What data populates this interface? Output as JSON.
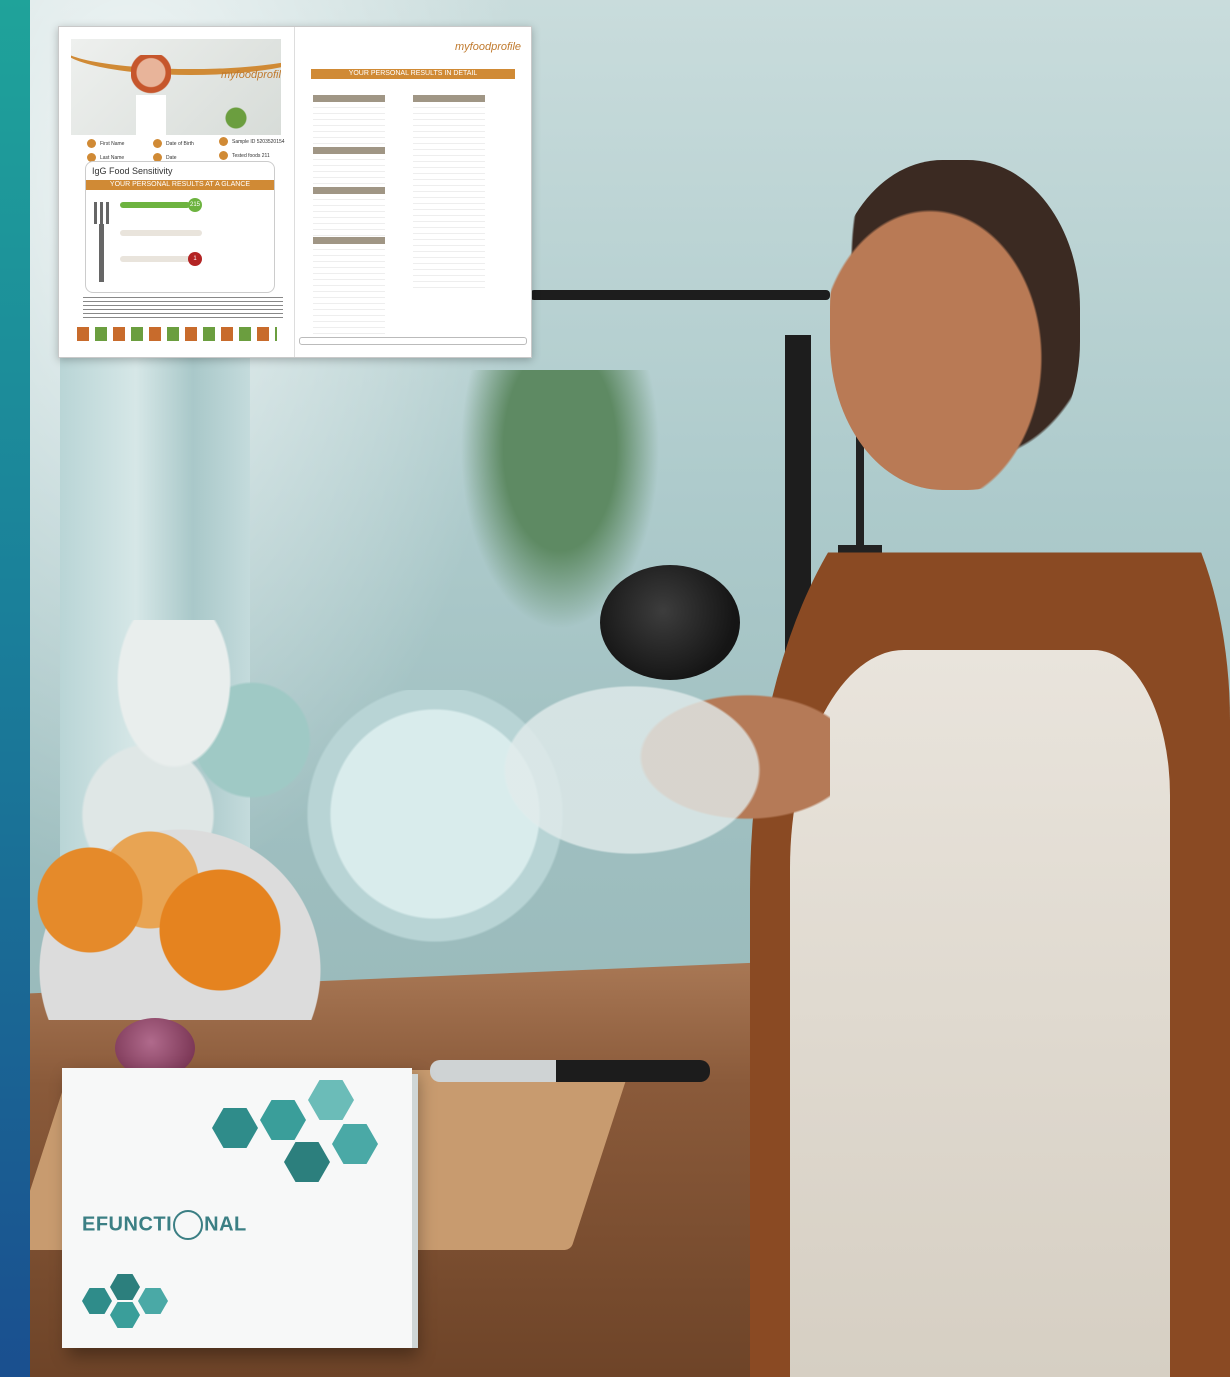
{
  "report": {
    "left_logo": "myfoodprofile",
    "right_logo": "myfoodprofile",
    "meta_items": [
      "First Name",
      "Date of Birth",
      "Sample ID",
      "Last Name",
      "Date",
      "Tested foods"
    ],
    "meta_values": [
      "",
      "",
      "5203520154",
      "",
      "",
      "211"
    ],
    "panel_title": "IgG Food Sensitivity",
    "panel_band": "YOUR PERSONAL RESULTS AT A GLANCE",
    "count_green": "215",
    "count_red": "1",
    "right_title": "YOUR PERSONAL RESULTS IN DETAIL"
  },
  "product": {
    "brand": "EFUNCTI",
    "brand_suffix": "NAL"
  },
  "colors": {
    "accent_orange": "#d08a35",
    "teal_brand": "#3b7f84",
    "side_band_top": "#1fa39a",
    "side_band_bottom": "#1a4f8f"
  }
}
